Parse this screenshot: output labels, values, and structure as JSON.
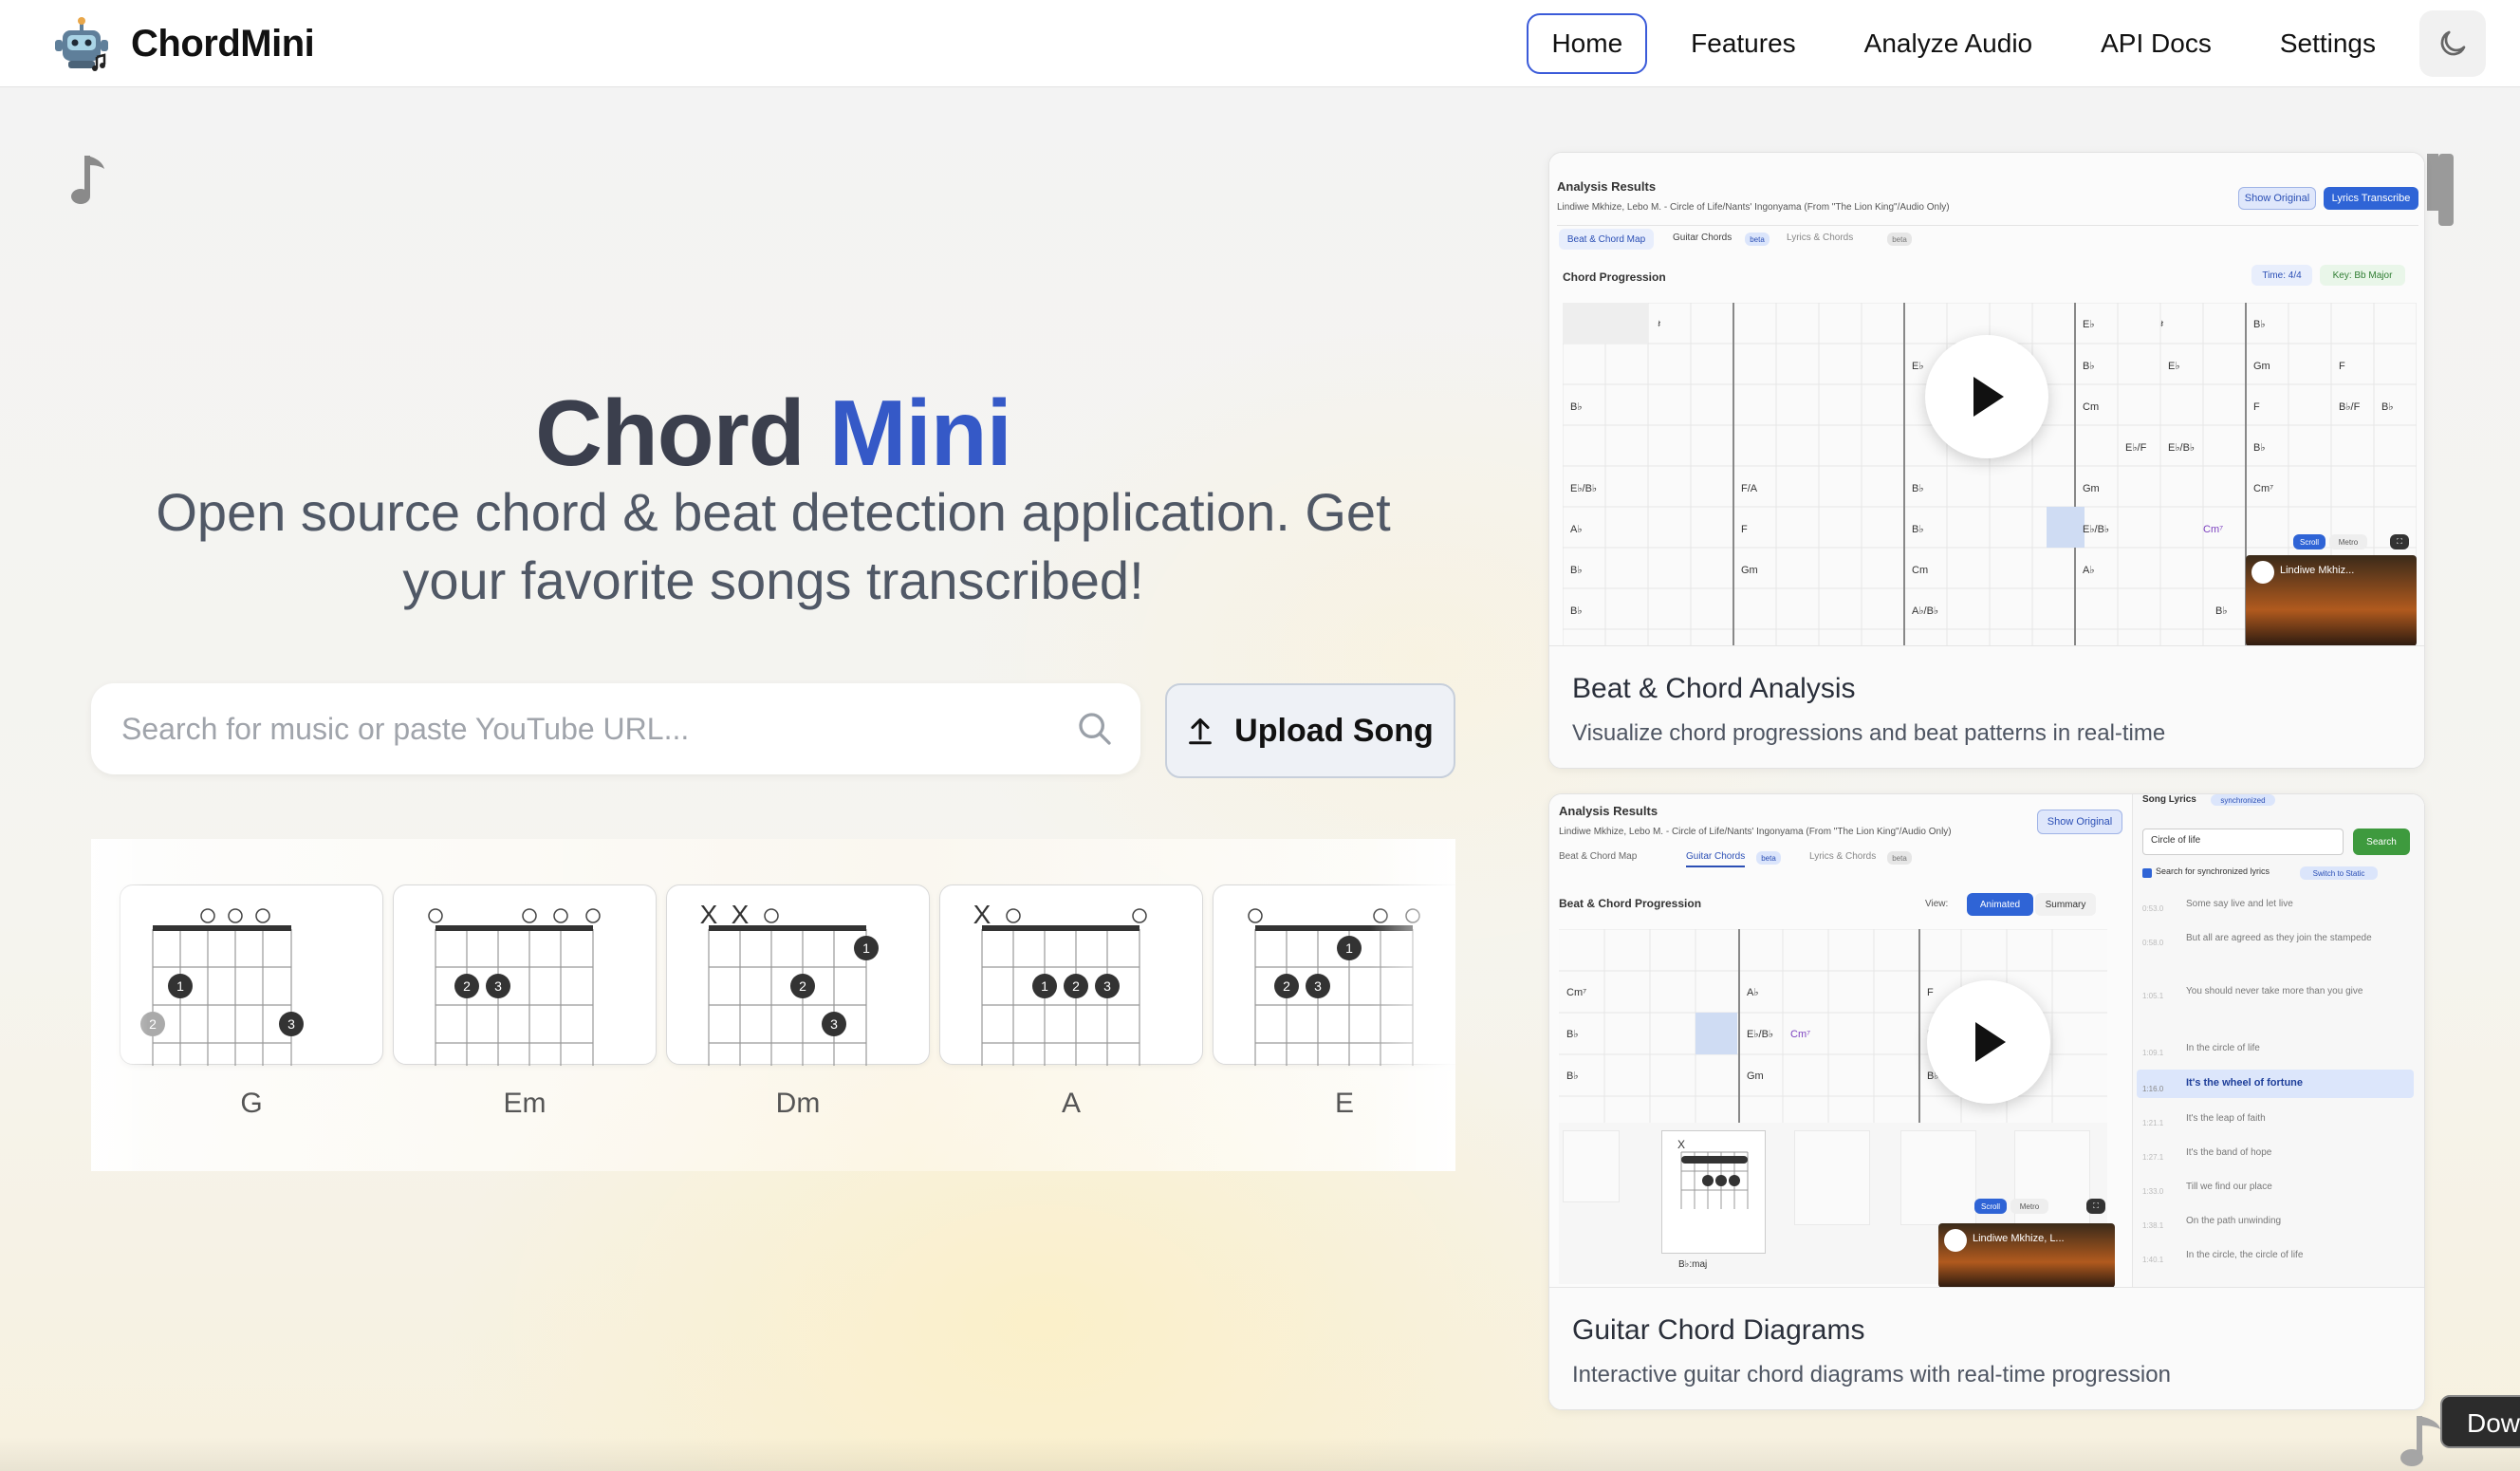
{
  "app": {
    "name": "ChordMini"
  },
  "nav": {
    "items": [
      {
        "label": "Home",
        "active": true
      },
      {
        "label": "Features"
      },
      {
        "label": "Analyze Audio"
      },
      {
        "label": "API Docs"
      },
      {
        "label": "Settings"
      }
    ],
    "theme_toggle_icon": "moon-icon"
  },
  "hero": {
    "title_word1": "Chord",
    "title_word2": "Mini",
    "subtitle": "Open source chord & beat detection application. Get your favorite songs transcribed!"
  },
  "search": {
    "placeholder": "Search for music or paste YouTube URL...",
    "value": ""
  },
  "upload": {
    "label": "Upload Song"
  },
  "chords": [
    {
      "name": "G"
    },
    {
      "name": "Em"
    },
    {
      "name": "Dm"
    },
    {
      "name": "A"
    },
    {
      "name": "E"
    }
  ],
  "features": [
    {
      "title": "Beat & Chord Analysis",
      "description": "Visualize chord progressions and beat patterns in real-time",
      "preview": {
        "heading": "Analysis Results",
        "song": "Lindiwe Mkhize, Lebo M. - Circle of Life/Nants' Ingonyama (From \"The Lion King\"/Audio Only)",
        "tabs": [
          "Beat & Chord Map",
          "Guitar Chords",
          "Lyrics & Chords"
        ],
        "badge": "beta",
        "buttons": [
          "Show Original",
          "Lyrics Transcribe"
        ],
        "section": "Chord Progression",
        "time": "Time: 4/4",
        "key": "Key: Bb Major",
        "chords": [
          "E♭",
          "B♭",
          "E♭",
          "B♭",
          "Gm",
          "F",
          "B♭",
          "Cm",
          "B♭/F",
          "B♭",
          "E♭/F",
          "E♭/B♭",
          "B♭",
          "E♭/B♭",
          "F/A",
          "Gm",
          "Cm⁷",
          "A♭",
          "F",
          "E♭/B♭",
          "Cm⁷",
          "B♭",
          "Gm",
          "Cm",
          "A♭",
          "B♭",
          "A♭/B♭",
          "B♭"
        ],
        "video_title": "Lindiwe Mkhiz...",
        "controls": [
          "Scroll",
          "Metro"
        ]
      }
    },
    {
      "title": "Guitar Chord Diagrams",
      "description": "Interactive guitar chord diagrams with real-time progression",
      "preview": {
        "heading": "Analysis Results",
        "song": "Lindiwe Mkhize, Lebo M. - Circle of Life/Nants' Ingonyama (From \"The Lion King\"/Audio Only)",
        "tabs": [
          "Beat & Chord Map",
          "Guitar Chords",
          "Lyrics & Chords"
        ],
        "badge": "beta",
        "button": "Show Original",
        "section": "Beat & Chord Progression",
        "view_label": "View:",
        "view_options": [
          "Animated",
          "Summary"
        ],
        "chords": [
          "Cm⁷",
          "A♭",
          "F",
          "B♭",
          "E♭/B♭",
          "Cm⁷",
          "F",
          "B♭",
          "Gm"
        ],
        "diagram_label": "B♭:maj",
        "lyrics_panel": {
          "title": "Song Lyrics",
          "badge": "synchronized",
          "search_value": "Circle of life",
          "search_button": "Search",
          "checkbox_label": "Search for synchronized lyrics",
          "switch_label": "Switch to Static",
          "lines": [
            {
              "time": "0:53.0",
              "text": "Some say live and let live"
            },
            {
              "time": "0:58.0",
              "text": "But all are agreed as they join the stampede"
            },
            {
              "time": "1:05.1",
              "text": "You should never take more than you give"
            },
            {
              "time": "1:09.1",
              "text": "In the circle of life"
            },
            {
              "time": "1:16.0",
              "text": "It's the wheel of fortune",
              "active": true
            },
            {
              "time": "1:21.1",
              "text": "It's the leap of faith"
            },
            {
              "time": "1:27.1",
              "text": "It's the band of hope"
            },
            {
              "time": "1:33.0",
              "text": "Till we find our place"
            },
            {
              "time": "1:38.1",
              "text": "On the path unwinding"
            },
            {
              "time": "1:40.1",
              "text": "In the circle, the circle of life"
            }
          ]
        },
        "video_title": "Lindiwe Mkhize, L...",
        "controls": [
          "Scroll",
          "Metro"
        ]
      }
    }
  ],
  "download_tag": "Dow"
}
